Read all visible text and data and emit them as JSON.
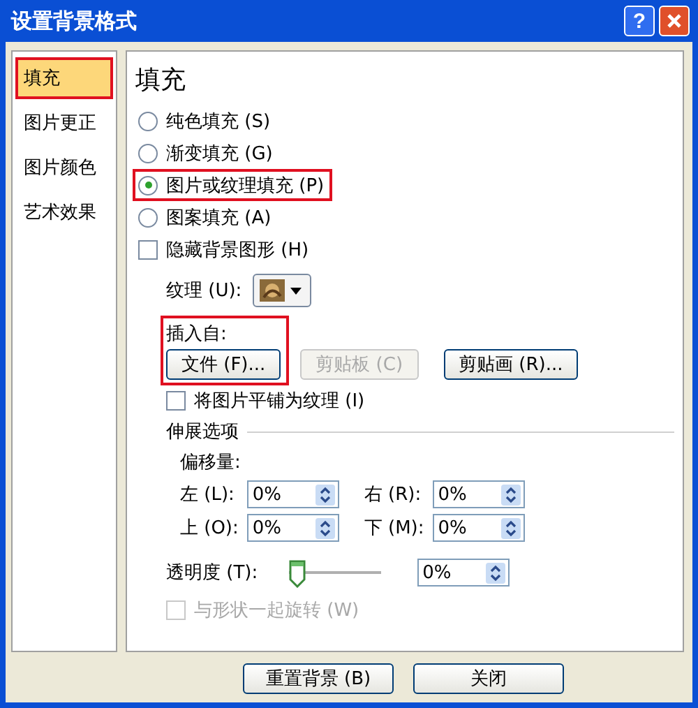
{
  "window": {
    "title": "设置背景格式",
    "help": "?"
  },
  "sidebar": {
    "items": [
      {
        "label": "填充",
        "selected": true,
        "annotated": true
      },
      {
        "label": "图片更正",
        "selected": false,
        "annotated": false
      },
      {
        "label": "图片颜色",
        "selected": false,
        "annotated": false
      },
      {
        "label": "艺术效果",
        "selected": false,
        "annotated": false
      }
    ]
  },
  "panel": {
    "heading": "填充",
    "fill_options": [
      {
        "label": "纯色填充 (S)",
        "selected": false,
        "annotated": false
      },
      {
        "label": "渐变填充 (G)",
        "selected": false,
        "annotated": false
      },
      {
        "label": "图片或纹理填充 (P)",
        "selected": true,
        "annotated": true
      },
      {
        "label": "图案填充 (A)",
        "selected": false,
        "annotated": false
      }
    ],
    "hide_background": {
      "label": "隐藏背景图形 (H)",
      "checked": false
    },
    "texture": {
      "label": "纹理 (U):"
    },
    "insert_from": {
      "label": "插入自:",
      "annotated": true,
      "buttons": [
        {
          "label": "文件 (F)...",
          "disabled": false
        },
        {
          "label": "剪贴板 (C)",
          "disabled": true
        },
        {
          "label": "剪贴画 (R)...",
          "disabled": false
        }
      ]
    },
    "tile": {
      "label": "将图片平铺为纹理 (I)",
      "checked": false
    },
    "stretch": {
      "title": "伸展选项",
      "offset_label": "偏移量:",
      "offsets": [
        {
          "label": "左 (L):",
          "value": "0%"
        },
        {
          "label": "右 (R):",
          "value": "0%"
        },
        {
          "label": "上 (O):",
          "value": "0%"
        },
        {
          "label": "下 (M):",
          "value": "0%"
        }
      ]
    },
    "transparency": {
      "label": "透明度 (T):",
      "level": 0,
      "value": "0%"
    },
    "rotate": {
      "label": "与形状一起旋转 (W)",
      "checked": false,
      "disabled": true
    }
  },
  "buttons": [
    {
      "label": "重置背景 (B)"
    },
    {
      "label": "关闭"
    }
  ]
}
